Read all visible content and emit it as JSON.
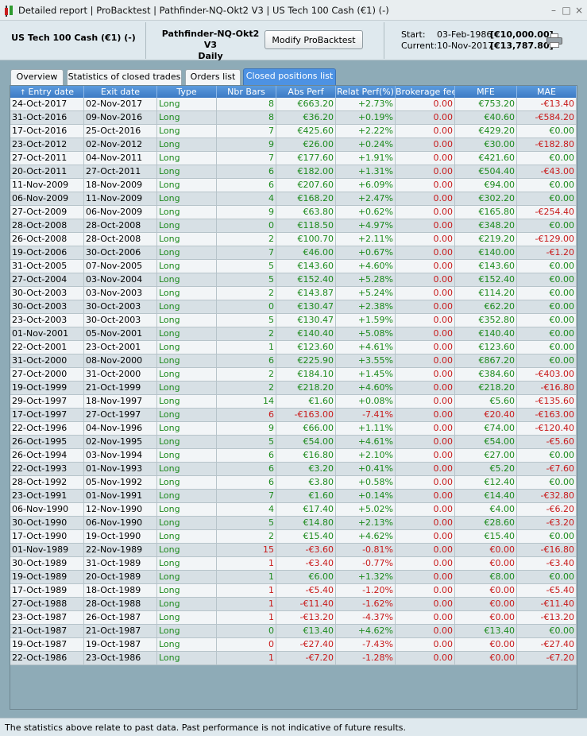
{
  "window": {
    "title": "Detailed report  |  ProBacktest  |  Pathfinder-NQ-Okt2 V3  |  US Tech 100 Cash (€1) (-)",
    "controls": [
      "–",
      "□",
      "×"
    ]
  },
  "header": {
    "instrument": "US Tech 100 Cash (€1) (-)",
    "system_name": "Pathfinder-NQ-Okt2 V3",
    "timeframe": "Daily",
    "modify_label": "Modify ProBacktest",
    "start_label": "Start:",
    "start_date": "03-Feb-1986",
    "start_capital": "[€10,000.00]",
    "current_label": "Current:",
    "current_date": "10-Nov-2017",
    "current_capital": "[€13,787.80]"
  },
  "tabs": [
    {
      "label": "Overview",
      "active": false
    },
    {
      "label": "Statistics of closed trades",
      "active": false
    },
    {
      "label": "Orders list",
      "active": false
    },
    {
      "label": "Closed positions list",
      "active": true
    }
  ],
  "table": {
    "sort_icon": "↑",
    "columns": [
      "Entry date",
      "Exit date",
      "Type",
      "Nbr Bars",
      "Abs Perf",
      "Relat Perf(%)",
      "Brokerage fee",
      "MFE",
      "MAE"
    ],
    "rows": [
      [
        "24-Oct-2017",
        "02-Nov-2017",
        "Long",
        "8",
        "€663.20",
        "+2.73%",
        "0.00",
        "€753.20",
        "-€13.40"
      ],
      [
        "31-Oct-2016",
        "09-Nov-2016",
        "Long",
        "8",
        "€36.20",
        "+0.19%",
        "0.00",
        "€40.60",
        "-€584.20"
      ],
      [
        "17-Oct-2016",
        "25-Oct-2016",
        "Long",
        "7",
        "€425.60",
        "+2.22%",
        "0.00",
        "€429.20",
        "€0.00"
      ],
      [
        "23-Oct-2012",
        "02-Nov-2012",
        "Long",
        "9",
        "€26.00",
        "+0.24%",
        "0.00",
        "€30.00",
        "-€182.80"
      ],
      [
        "27-Oct-2011",
        "04-Nov-2011",
        "Long",
        "7",
        "€177.60",
        "+1.91%",
        "0.00",
        "€421.60",
        "€0.00"
      ],
      [
        "20-Oct-2011",
        "27-Oct-2011",
        "Long",
        "6",
        "€182.00",
        "+1.31%",
        "0.00",
        "€504.40",
        "-€43.00"
      ],
      [
        "11-Nov-2009",
        "18-Nov-2009",
        "Long",
        "6",
        "€207.60",
        "+6.09%",
        "0.00",
        "€94.00",
        "€0.00"
      ],
      [
        "06-Nov-2009",
        "11-Nov-2009",
        "Long",
        "4",
        "€168.20",
        "+2.47%",
        "0.00",
        "€302.20",
        "€0.00"
      ],
      [
        "27-Oct-2009",
        "06-Nov-2009",
        "Long",
        "9",
        "€63.80",
        "+0.62%",
        "0.00",
        "€165.80",
        "-€254.40"
      ],
      [
        "28-Oct-2008",
        "28-Oct-2008",
        "Long",
        "0",
        "€118.50",
        "+4.97%",
        "0.00",
        "€348.20",
        "€0.00"
      ],
      [
        "26-Oct-2008",
        "28-Oct-2008",
        "Long",
        "2",
        "€100.70",
        "+2.11%",
        "0.00",
        "€219.20",
        "-€129.00"
      ],
      [
        "19-Oct-2006",
        "30-Oct-2006",
        "Long",
        "7",
        "€46.00",
        "+0.67%",
        "0.00",
        "€140.00",
        "-€1.20"
      ],
      [
        "31-Oct-2005",
        "07-Nov-2005",
        "Long",
        "5",
        "€143.60",
        "+4.60%",
        "0.00",
        "€143.60",
        "€0.00"
      ],
      [
        "27-Oct-2004",
        "03-Nov-2004",
        "Long",
        "5",
        "€152.40",
        "+5.28%",
        "0.00",
        "€152.40",
        "€0.00"
      ],
      [
        "30-Oct-2003",
        "03-Nov-2003",
        "Long",
        "2",
        "€143.87",
        "+5.24%",
        "0.00",
        "€114.20",
        "€0.00"
      ],
      [
        "30-Oct-2003",
        "30-Oct-2003",
        "Long",
        "0",
        "€130.47",
        "+2.38%",
        "0.00",
        "€62.20",
        "€0.00"
      ],
      [
        "23-Oct-2003",
        "30-Oct-2003",
        "Long",
        "5",
        "€130.47",
        "+1.59%",
        "0.00",
        "€352.80",
        "€0.00"
      ],
      [
        "01-Nov-2001",
        "05-Nov-2001",
        "Long",
        "2",
        "€140.40",
        "+5.08%",
        "0.00",
        "€140.40",
        "€0.00"
      ],
      [
        "22-Oct-2001",
        "23-Oct-2001",
        "Long",
        "1",
        "€123.60",
        "+4.61%",
        "0.00",
        "€123.60",
        "€0.00"
      ],
      [
        "31-Oct-2000",
        "08-Nov-2000",
        "Long",
        "6",
        "€225.90",
        "+3.55%",
        "0.00",
        "€867.20",
        "€0.00"
      ],
      [
        "27-Oct-2000",
        "31-Oct-2000",
        "Long",
        "2",
        "€184.10",
        "+1.45%",
        "0.00",
        "€384.60",
        "-€403.00"
      ],
      [
        "19-Oct-1999",
        "21-Oct-1999",
        "Long",
        "2",
        "€218.20",
        "+4.60%",
        "0.00",
        "€218.20",
        "-€16.80"
      ],
      [
        "29-Oct-1997",
        "18-Nov-1997",
        "Long",
        "14",
        "€1.60",
        "+0.08%",
        "0.00",
        "€5.60",
        "-€135.60"
      ],
      [
        "17-Oct-1997",
        "27-Oct-1997",
        "Long",
        "6",
        "-€163.00",
        "-7.41%",
        "0.00",
        "€20.40",
        "-€163.00"
      ],
      [
        "22-Oct-1996",
        "04-Nov-1996",
        "Long",
        "9",
        "€66.00",
        "+1.11%",
        "0.00",
        "€74.00",
        "-€120.40"
      ],
      [
        "26-Oct-1995",
        "02-Nov-1995",
        "Long",
        "5",
        "€54.00",
        "+4.61%",
        "0.00",
        "€54.00",
        "-€5.60"
      ],
      [
        "26-Oct-1994",
        "03-Nov-1994",
        "Long",
        "6",
        "€16.80",
        "+2.10%",
        "0.00",
        "€27.00",
        "€0.00"
      ],
      [
        "22-Oct-1993",
        "01-Nov-1993",
        "Long",
        "6",
        "€3.20",
        "+0.41%",
        "0.00",
        "€5.20",
        "-€7.60"
      ],
      [
        "28-Oct-1992",
        "05-Nov-1992",
        "Long",
        "6",
        "€3.80",
        "+0.58%",
        "0.00",
        "€12.40",
        "€0.00"
      ],
      [
        "23-Oct-1991",
        "01-Nov-1991",
        "Long",
        "7",
        "€1.60",
        "+0.14%",
        "0.00",
        "€14.40",
        "-€32.80"
      ],
      [
        "06-Nov-1990",
        "12-Nov-1990",
        "Long",
        "4",
        "€17.40",
        "+5.02%",
        "0.00",
        "€4.00",
        "-€6.20"
      ],
      [
        "30-Oct-1990",
        "06-Nov-1990",
        "Long",
        "5",
        "€14.80",
        "+2.13%",
        "0.00",
        "€28.60",
        "-€3.20"
      ],
      [
        "17-Oct-1990",
        "19-Oct-1990",
        "Long",
        "2",
        "€15.40",
        "+4.62%",
        "0.00",
        "€15.40",
        "€0.00"
      ],
      [
        "01-Nov-1989",
        "22-Nov-1989",
        "Long",
        "15",
        "-€3.60",
        "-0.81%",
        "0.00",
        "€0.00",
        "-€16.80"
      ],
      [
        "30-Oct-1989",
        "31-Oct-1989",
        "Long",
        "1",
        "-€3.40",
        "-0.77%",
        "0.00",
        "€0.00",
        "-€3.40"
      ],
      [
        "19-Oct-1989",
        "20-Oct-1989",
        "Long",
        "1",
        "€6.00",
        "+1.32%",
        "0.00",
        "€8.00",
        "€0.00"
      ],
      [
        "17-Oct-1989",
        "18-Oct-1989",
        "Long",
        "1",
        "-€5.40",
        "-1.20%",
        "0.00",
        "€0.00",
        "-€5.40"
      ],
      [
        "27-Oct-1988",
        "28-Oct-1988",
        "Long",
        "1",
        "-€11.40",
        "-1.62%",
        "0.00",
        "€0.00",
        "-€11.40"
      ],
      [
        "23-Oct-1987",
        "26-Oct-1987",
        "Long",
        "1",
        "-€13.20",
        "-4.37%",
        "0.00",
        "€0.00",
        "-€13.20"
      ],
      [
        "21-Oct-1987",
        "21-Oct-1987",
        "Long",
        "0",
        "€13.40",
        "+4.62%",
        "0.00",
        "€13.40",
        "€0.00"
      ],
      [
        "19-Oct-1987",
        "19-Oct-1987",
        "Long",
        "0",
        "-€27.40",
        "-7.43%",
        "0.00",
        "€0.00",
        "-€27.40"
      ],
      [
        "22-Oct-1986",
        "23-Oct-1986",
        "Long",
        "1",
        "-€7.20",
        "-1.28%",
        "0.00",
        "€0.00",
        "-€7.20"
      ]
    ]
  },
  "footer": {
    "disclaimer": "The statistics above relate to past data. Past performance is not indicative of future results."
  },
  "colors": {
    "positive": "#1c8a1c",
    "negative": "#c81a1a",
    "header_blue": "#3c7ac4",
    "tab_active": "#4d92e3"
  }
}
